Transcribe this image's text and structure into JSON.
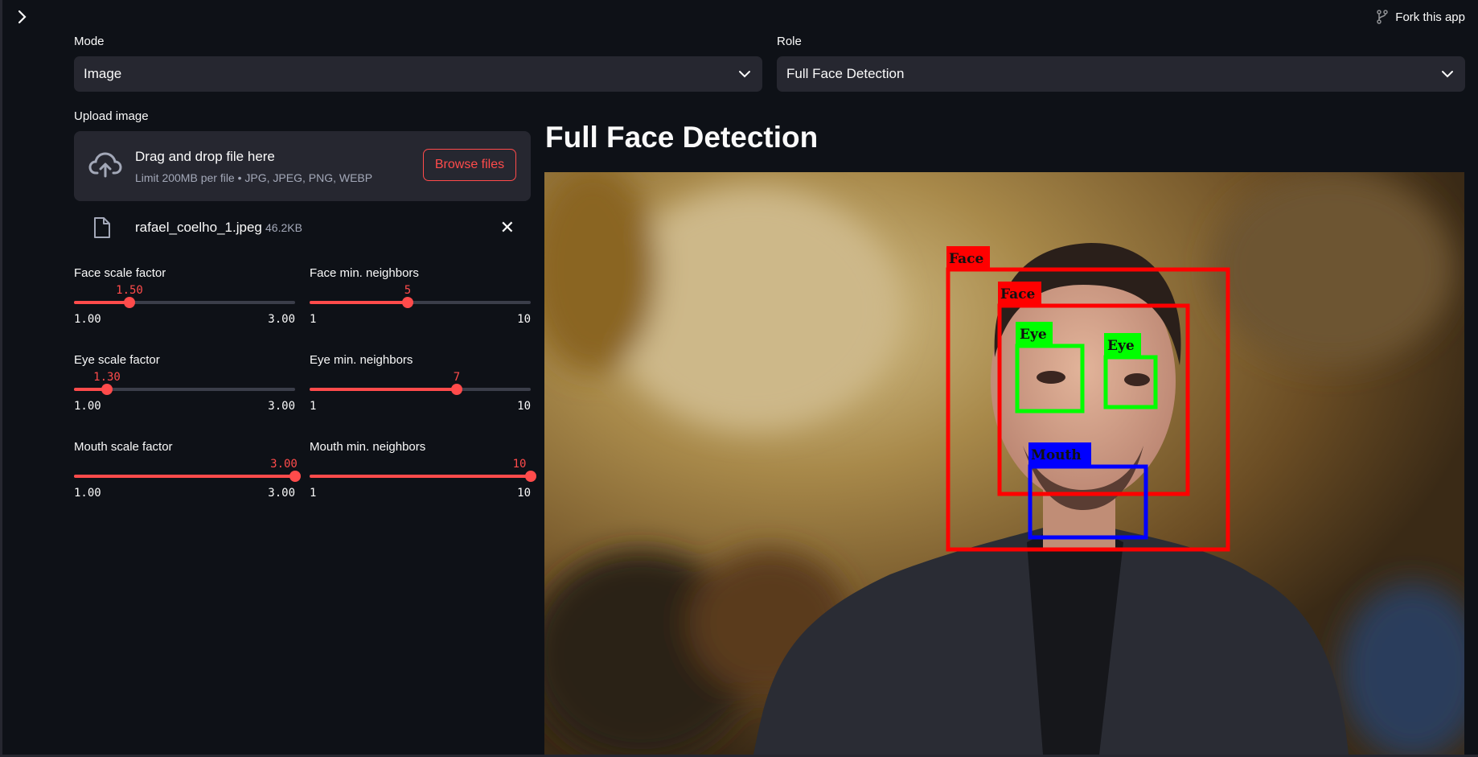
{
  "header": {
    "fork_label": "Fork this app"
  },
  "mode": {
    "label": "Mode",
    "value": "Image"
  },
  "role": {
    "label": "Role",
    "value": "Full Face Detection"
  },
  "upload": {
    "label": "Upload image",
    "title": "Drag and drop file here",
    "subtitle": "Limit 200MB per file • JPG, JPEG, PNG, WEBP",
    "browse_label": "Browse files",
    "file": {
      "name": "rafael_coelho_1.jpeg",
      "size": "46.2KB"
    }
  },
  "sliders": [
    {
      "id": "face-scale",
      "label": "Face scale factor",
      "value": "1.50",
      "min": "1.00",
      "max": "3.00",
      "fraction": 0.25
    },
    {
      "id": "face-neighbors",
      "label": "Face min. neighbors",
      "value": "5",
      "min": "1",
      "max": "10",
      "fraction": 0.444
    },
    {
      "id": "eye-scale",
      "label": "Eye scale factor",
      "value": "1.30",
      "min": "1.00",
      "max": "3.00",
      "fraction": 0.15
    },
    {
      "id": "eye-neighbors",
      "label": "Eye min. neighbors",
      "value": "7",
      "min": "1",
      "max": "10",
      "fraction": 0.667
    },
    {
      "id": "mouth-scale",
      "label": "Mouth scale factor",
      "value": "3.00",
      "min": "1.00",
      "max": "3.00",
      "fraction": 1.0
    },
    {
      "id": "mouth-neighbors",
      "label": "Mouth min. neighbors",
      "value": "10",
      "min": "1",
      "max": "10",
      "fraction": 1.0
    }
  ],
  "result": {
    "title": "Full Face Detection",
    "detections": [
      {
        "label": "Face",
        "color": "#ff0000"
      },
      {
        "label": "Face",
        "color": "#ff0000"
      },
      {
        "label": "Eye",
        "color": "#00ff00"
      },
      {
        "label": "Eye",
        "color": "#00ff00"
      },
      {
        "label": "Mouth",
        "color": "#0000ff"
      }
    ]
  },
  "colors": {
    "accent": "#ff4b4b",
    "background": "#0e1117",
    "widget": "#262730"
  }
}
